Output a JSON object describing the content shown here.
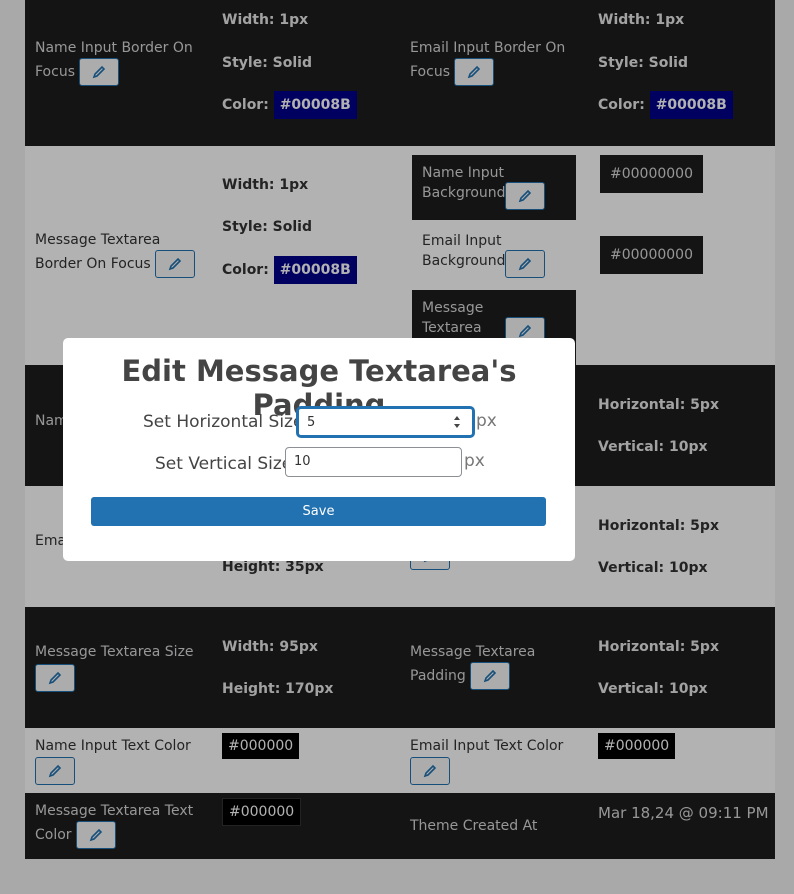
{
  "rows": {
    "r1": {
      "left_label": "Name Input Border On Focus",
      "left_width": "Width: 1px",
      "left_style": "Style: Solid",
      "left_color_label": "Color:",
      "left_color": "#00008B",
      "right_label": "Email Input Border On Focus",
      "right_width": "Width: 1px",
      "right_style": "Style: Solid",
      "right_color_label": "Color:",
      "right_color": "#00008B"
    },
    "r2": {
      "left_label": "Message Textarea Border On Focus",
      "left_width": "Width: 1px",
      "left_style": "Style: Solid",
      "left_color_label": "Color:",
      "left_color": "#00008B",
      "bg_name_label": "Name Input Background",
      "bg_name_value": "#00000000",
      "bg_email_label": "Email Input Background",
      "bg_email_value": "#00000000",
      "bg_msg_label": "Message Textarea Background"
    },
    "r3": {
      "left_label_partial": "Nam",
      "right_h": "Horizontal: 5px",
      "right_v": "Vertical: 10px"
    },
    "r4": {
      "left_label_partial": "Ema",
      "mid_height": "Height: 35px",
      "right_h": "Horizontal: 5px",
      "right_v": "Vertical: 10px"
    },
    "r5": {
      "left_label": "Message Textarea Size",
      "left_width": "Width: 95px",
      "left_height": "Height: 170px",
      "right_label": "Message Textarea Padding",
      "right_h": "Horizontal: 5px",
      "right_v": "Vertical: 10px"
    },
    "r6": {
      "left_label": "Name Input Text Color",
      "left_color": "#000000",
      "right_label": "Email Input Text Color",
      "right_color": "#000000"
    },
    "r7": {
      "left_label": "Message Textarea Text Color",
      "left_color": "#000000",
      "right_label": "Theme Created At",
      "right_value": "Mar 18,24 @ 09:11 PM"
    }
  },
  "modal": {
    "title": "Edit Message Textarea's Padding",
    "horizontal_label": "Set Horizontal Size",
    "horizontal_value": "5",
    "vertical_label": "Set Vertical Size",
    "vertical_value": "10",
    "unit": "px",
    "save_label": "Save"
  },
  "icons": {
    "edit": "pencil-icon"
  },
  "colors": {
    "accent": "#2271b1",
    "dark_row": "#1d1d1f",
    "swatch_blue": "#00008B",
    "swatch_black": "#000000"
  }
}
